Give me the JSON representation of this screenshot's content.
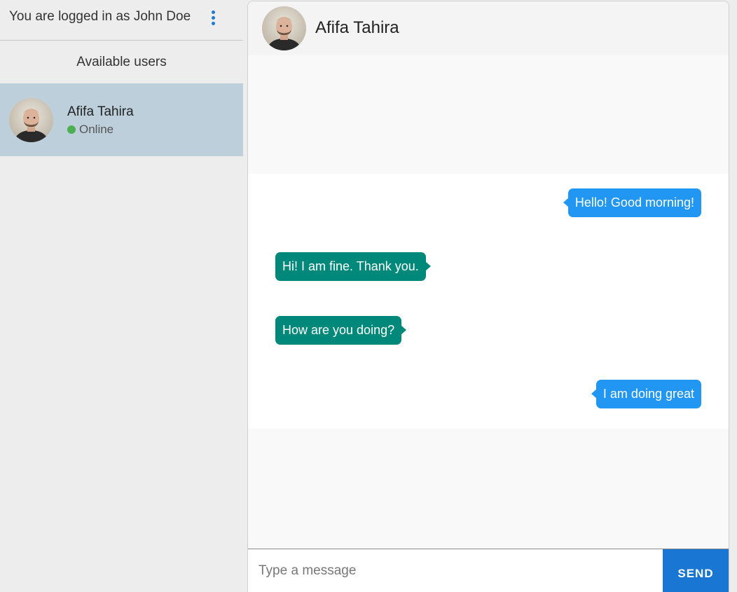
{
  "sidebar": {
    "login_text": "You are logged in as John Doe",
    "menu_icon": "more-vert-icon",
    "available_heading": "Available users",
    "users": [
      {
        "name": "Afifa Tahira",
        "status": "Online",
        "status_color": "#4caf50",
        "selected": true
      }
    ]
  },
  "chat": {
    "title": "Afifa Tahira",
    "messages": [
      {
        "text": "Hello! Good morning!",
        "direction": "sent"
      },
      {
        "text": "Hi! I am fine. Thank you.",
        "direction": "received"
      },
      {
        "text": "How are you doing?",
        "direction": "received"
      },
      {
        "text": "I am doing great",
        "direction": "sent"
      }
    ],
    "input_placeholder": "Type a message",
    "send_label": "SEND"
  },
  "colors": {
    "sent_bubble": "#2196f3",
    "received_bubble": "#00897b",
    "send_button": "#1976d2",
    "selected_user_bg": "#bdcfda",
    "menu_icon": "#1e7ad6"
  }
}
